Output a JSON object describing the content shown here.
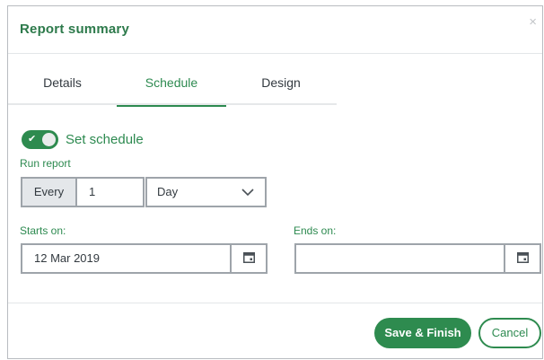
{
  "dialog": {
    "title": "Report summary",
    "close_glyph": "×"
  },
  "tabs": [
    {
      "label": "Details",
      "active": false
    },
    {
      "label": "Schedule",
      "active": true
    },
    {
      "label": "Design",
      "active": false
    }
  ],
  "schedule": {
    "toggle_label": "Set schedule",
    "toggle_on": true,
    "run_report_label": "Run report",
    "every_label": "Every",
    "interval_value": "1",
    "period_selected": "Day",
    "starts_on_label": "Starts on:",
    "starts_on_value": "12 Mar 2019",
    "ends_on_label": "Ends on:",
    "ends_on_value": ""
  },
  "footer": {
    "save_label": "Save & Finish",
    "cancel_label": "Cancel"
  },
  "colors": {
    "accent": "#2e8b4f",
    "accent_text": "#2d8a50",
    "border": "#9ea4aa",
    "readonly_bg": "#e4e7ea"
  },
  "icons": {
    "close": "close-icon",
    "toggle_check": "check-icon",
    "select": "chevron-down-icon",
    "calendar": "calendar-icon"
  }
}
